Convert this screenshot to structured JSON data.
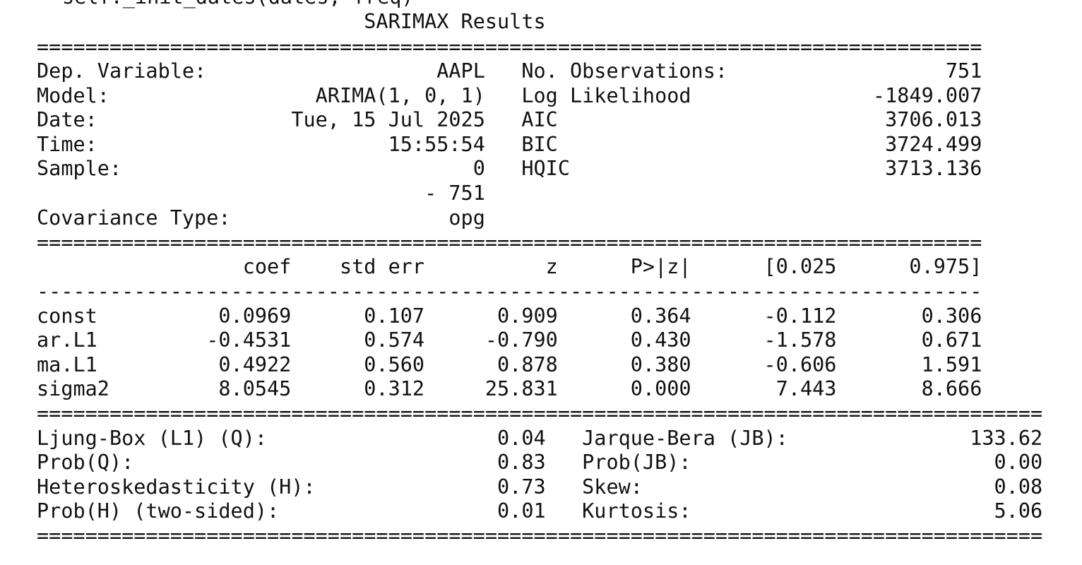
{
  "top_cutoff_line": "self._init_dates(dates, freq)",
  "title_line": "                           SARIMAX Results                                ",
  "rule_double_1": "==============================================================================",
  "header_lines": [
    "Dep. Variable:                   AAPL   No. Observations:                  751",
    "Model:                 ARIMA(1, 0, 1)   Log Likelihood               -1849.007",
    "Date:                Tue, 15 Jul 2025   AIC                           3706.013",
    "Time:                        15:55:54   BIC                           3724.499",
    "Sample:                             0   HQIC                          3713.136",
    "                                - 751                                         ",
    "Covariance Type:                  opg                                         "
  ],
  "rule_double_2": "==============================================================================",
  "coef_header_line": "                 coef    std err          z      P>|z|      [0.025      0.975]",
  "rule_single": "------------------------------------------------------------------------------",
  "coef_rows": [
    "const          0.0969      0.107      0.909      0.364      -0.112       0.306",
    "ar.L1         -0.4531      0.574     -0.790      0.430      -1.578       0.671",
    "ma.L1          0.4922      0.560      0.878      0.380      -0.606       1.591",
    "sigma2         8.0545      0.312     25.831      0.000       7.443       8.666"
  ],
  "rule_double_3": "===================================================================================",
  "diag_lines": [
    "Ljung-Box (L1) (Q):                   0.04   Jarque-Bera (JB):               133.62",
    "Prob(Q):                              0.83   Prob(JB):                         0.00",
    "Heteroskedasticity (H):               0.73   Skew:                             0.08",
    "Prob(H) (two-sided):                  0.01   Kurtosis:                         5.06"
  ],
  "rule_double_4": "==================================================================================="
}
